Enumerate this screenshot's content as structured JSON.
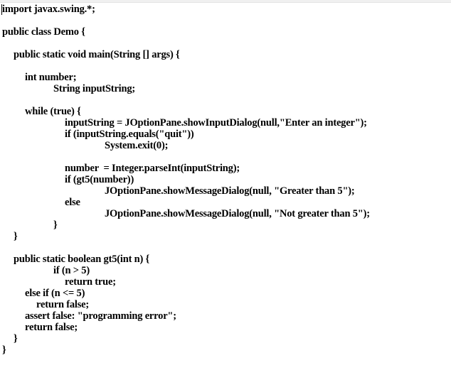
{
  "document": {
    "lines": [
      {
        "text": "import javax.swing.*;",
        "indent": "none"
      },
      {
        "text": "public class Demo {",
        "indent": "none"
      },
      {
        "text": "public static void main(String [] args) {",
        "indent": "level1"
      },
      {
        "text": "int number;",
        "indent": "level2"
      },
      {
        "text": "String inputString;",
        "indent": "level3"
      },
      {
        "text": "while (true) {",
        "indent": "level2"
      },
      {
        "text": "inputString = JOptionPane.showInputDialog(null,\"Enter an integer\");",
        "indent": "level4"
      },
      {
        "text": "if (inputString.equals(\"quit\"))",
        "indent": "level4"
      },
      {
        "text": "System.exit(0);",
        "indent": "level5"
      },
      {
        "text": "number  = Integer.parseInt(inputString);",
        "indent": "level4"
      },
      {
        "text": "if (gt5(number))",
        "indent": "level4"
      },
      {
        "text": "JOptionPane.showMessageDialog(null, \"Greater than 5\");",
        "indent": "level5"
      },
      {
        "text": "else",
        "indent": "level4"
      },
      {
        "text": "JOptionPane.showMessageDialog(null, \"Not greater than 5\");",
        "indent": "level5"
      },
      {
        "text": "}",
        "indent": "level3"
      },
      {
        "text": "}",
        "indent": "level1"
      },
      {
        "text": "public static boolean gt5(int n) {",
        "indent": "level1"
      },
      {
        "text": "if (n > 5)",
        "indent": "level3"
      },
      {
        "text": "return true;",
        "indent": "level4"
      },
      {
        "text": "else if (n <= 5)",
        "indent": "level2"
      },
      {
        "text": "return false;",
        "indent": "level2b"
      },
      {
        "text": "assert false: \"programming error\";",
        "indent": "level2"
      },
      {
        "text": "return false;",
        "indent": "level2"
      },
      {
        "text": "}",
        "indent": "level1"
      },
      {
        "text": "}",
        "indent": "none"
      }
    ]
  }
}
